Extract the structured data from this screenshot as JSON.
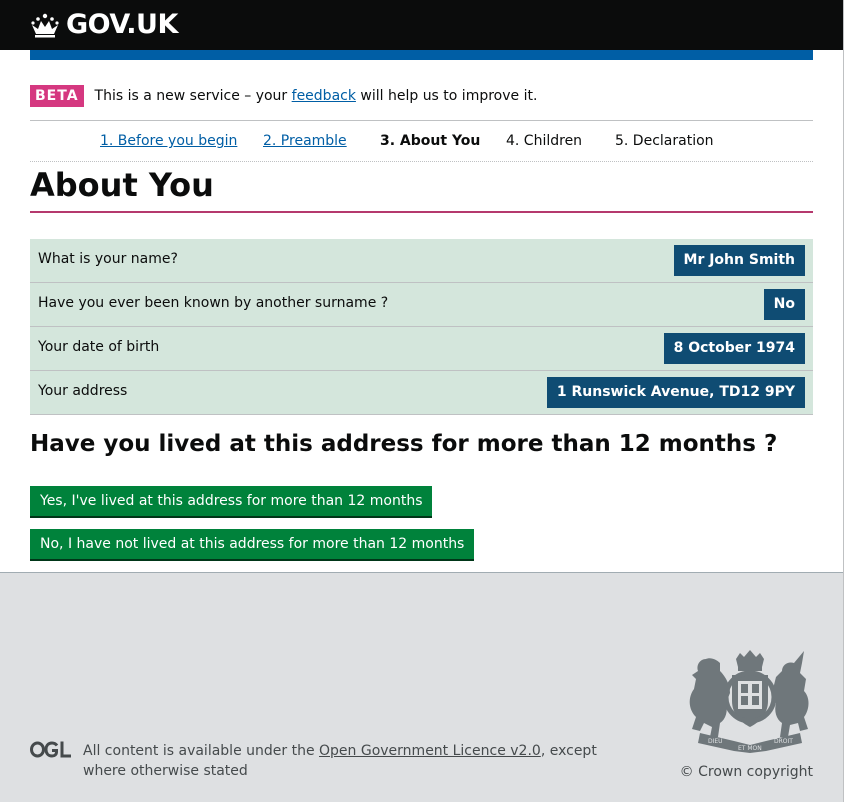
{
  "header": {
    "logo_text": "GOV.UK",
    "logo_icon": "crown-icon"
  },
  "phase_banner": {
    "tag": "BETA",
    "text_before": "This is a new service – your",
    "link": "feedback",
    "text_after": "will help us to improve it."
  },
  "steps": [
    {
      "label": "1. Before you begin",
      "state": "link"
    },
    {
      "label": "2. Preamble",
      "state": "link"
    },
    {
      "label": "3. About You",
      "state": "current"
    },
    {
      "label": "4. Children",
      "state": "upcoming"
    },
    {
      "label": "5. Declaration",
      "state": "upcoming"
    }
  ],
  "page_title": "About You",
  "summary": [
    {
      "question": "What is your name?",
      "answer": "Mr John Smith"
    },
    {
      "question": "Have you ever been known by another surname ?",
      "answer": "No"
    },
    {
      "question": "Your date of birth",
      "answer": "8 October 1974"
    },
    {
      "question": "Your address",
      "answer": "1 Runswick Avenue, TD12 9PY"
    }
  ],
  "question": "Have you lived at this address for more than 12 months ?",
  "buttons": {
    "yes": "Yes, I've lived at this address for more than 12 months",
    "no": "No, I have not lived at this address for more than 12 months"
  },
  "footer": {
    "ogl_logo": "OGL",
    "licence_before": "All content is available under the",
    "licence_link": "Open Government Licence v2.0",
    "licence_after": ", except where otherwise stated",
    "crest_icon": "royal-coat-of-arms-icon",
    "crest_motto_left": "DIEU",
    "crest_motto_mid": "ET MON",
    "crest_motto_right": "DROIT",
    "copyright": "© Crown copyright"
  },
  "colors": {
    "header_bg": "#0b0c0c",
    "header_bar": "#005ea5",
    "beta_tag": "#d53880",
    "link": "#005ea5",
    "title_rule": "#b5396d",
    "summary_bg": "#d4e6dc",
    "answer_bg": "#0f4c73",
    "button_green": "#00823b",
    "footer_bg": "#dee0e2"
  }
}
